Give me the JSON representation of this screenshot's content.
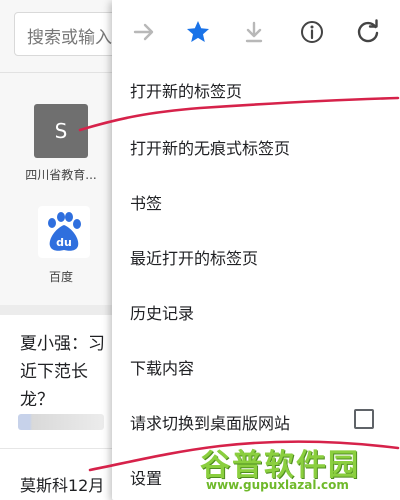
{
  "search": {
    "text": "搜索或输入"
  },
  "shortcuts": [
    {
      "letter": "S",
      "label": "四川省教育..."
    },
    {
      "logo_text": "du",
      "label": "百度"
    }
  ],
  "news": [
    {
      "title": "夏小强：习近下范长龙？"
    },
    {
      "title": "莫斯科12月"
    }
  ],
  "menu": {
    "toolbar": [
      {
        "icon": "forward-arrow-icon"
      },
      {
        "icon": "star-icon",
        "color": "#1a73e8"
      },
      {
        "icon": "download-icon"
      },
      {
        "icon": "info-icon"
      },
      {
        "icon": "reload-icon"
      }
    ],
    "items": [
      {
        "label": "打开新的标签页"
      },
      {
        "label": "打开新的无痕式标签页"
      },
      {
        "label": "书签"
      },
      {
        "label": "最近打开的标签页"
      },
      {
        "label": "历史记录"
      },
      {
        "label": "下载内容"
      },
      {
        "label": "请求切换到桌面版网站"
      },
      {
        "label": "设置"
      }
    ]
  },
  "watermark": {
    "brand": "谷普软件园",
    "url": "www.gupuxlazal.com"
  },
  "colors": {
    "accent": "#1a73e8",
    "annotation": "#d6224a",
    "watermark": "#8bcf3f"
  }
}
